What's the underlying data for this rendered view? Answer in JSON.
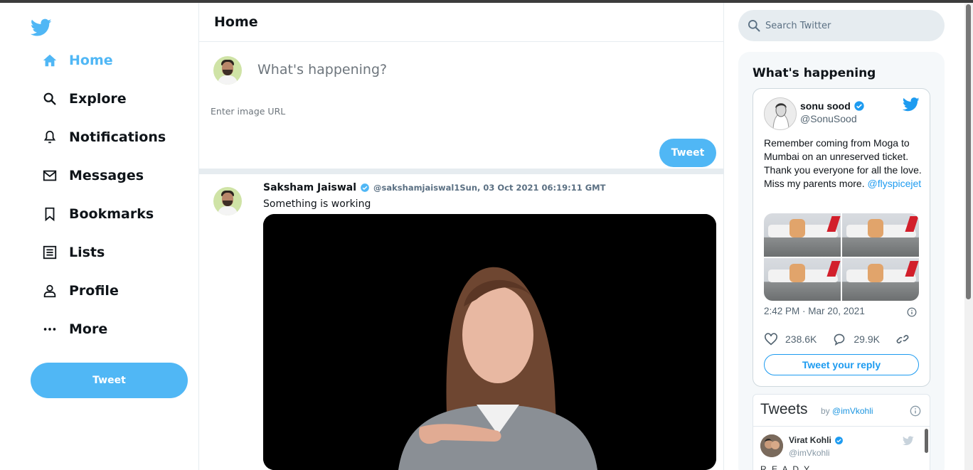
{
  "colors": {
    "accent": "#50b7f5",
    "text": "#0f1419",
    "muted": "#6e767d",
    "border": "#e6ecf0",
    "link": "#1d9bf0"
  },
  "sidebar": {
    "logo": "twitter-bird-icon",
    "items": [
      {
        "label": "Home",
        "icon": "home-icon",
        "active": true
      },
      {
        "label": "Explore",
        "icon": "search-icon"
      },
      {
        "label": "Notifications",
        "icon": "bell-icon"
      },
      {
        "label": "Messages",
        "icon": "mail-icon"
      },
      {
        "label": "Bookmarks",
        "icon": "bookmark-icon"
      },
      {
        "label": "Lists",
        "icon": "list-icon"
      },
      {
        "label": "Profile",
        "icon": "person-icon"
      },
      {
        "label": "More",
        "icon": "more-icon"
      }
    ],
    "tweet_button": "Tweet"
  },
  "feed": {
    "title": "Home",
    "compose": {
      "placeholder": "What's happening?",
      "image_placeholder": "Enter image URL",
      "tweet_button": "Tweet"
    },
    "posts": [
      {
        "name": "Saksham Jaiswal",
        "meta": "@sakshamjaiswal1Sun, 03 Oct 2021 06:19:11 GMT",
        "text": "Something is working"
      }
    ]
  },
  "search": {
    "placeholder": "Search Twitter"
  },
  "widgets": {
    "title": "What's happening",
    "embed": {
      "name": "sonu sood",
      "handle": "@SonuSood",
      "text": "Remember coming from Moga to Mumbai on an unreserved ticket. Thank you everyone for all the love. Miss my parents more.",
      "link": "@flyspicejet",
      "time": "2:42 PM · Mar 20, 2021",
      "likes": "238.6K",
      "replies": "29.9K",
      "reply_button": "Tweet your reply"
    },
    "timeline": {
      "title": "Tweets",
      "by": "by",
      "by_handle": "@imVkohli",
      "tweet_name": "Virat Kohli",
      "tweet_handle": "@imVkohli",
      "tweet_text": "R E A D Y"
    }
  }
}
